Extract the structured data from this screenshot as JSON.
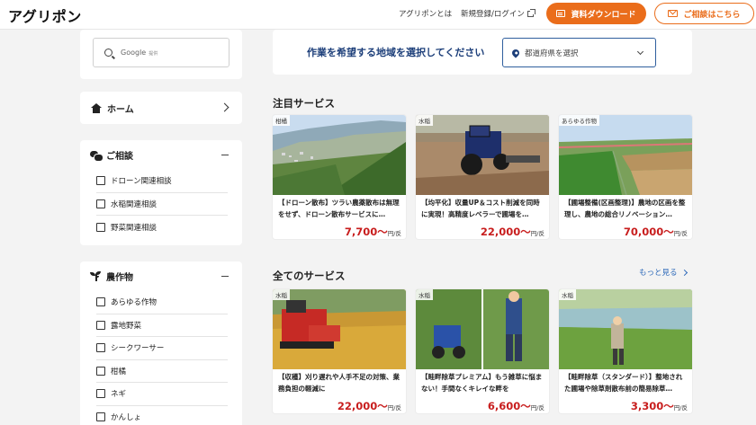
{
  "header": {
    "logo": "アグリポン",
    "nav_about": "アグリポンとは",
    "nav_login": "新規登録/ログイン",
    "download_button": "資料ダウンロード",
    "consult_button": "ご相談はこちら"
  },
  "sidebar": {
    "search": {
      "placeholder": "Google",
      "powered": "提供"
    },
    "home_label": "ホーム",
    "consult_group": {
      "title": "ご相談",
      "items": [
        "ドローン関連相談",
        "水稲関連相談",
        "野菜関連相談"
      ]
    },
    "crops_group": {
      "title": "農作物",
      "items": [
        "あらゆる作物",
        "露地野菜",
        "シークワーサー",
        "柑橘",
        "ネギ",
        "かんしょ"
      ]
    }
  },
  "main": {
    "region_prompt": "作業を希望する地域を選択してください",
    "region_select": "都道府県を選択",
    "featured_title": "注目サービス",
    "all_title": "全てのサービス",
    "more_link": "もっと見る",
    "price_unit": "円/反",
    "featured": [
      {
        "tag": "柑橘",
        "text": "【ドローン散布】ツラい農薬散布は無理をせず、ドローン散布サービスに…",
        "price": "7,700〜"
      },
      {
        "tag": "水稲",
        "text": "【均平化】収量UP＆コスト削減を同時に実現！高精度レベラーで圃場を…",
        "price": "22,000〜"
      },
      {
        "tag": "あらゆる作物",
        "text": "【圃場整備(区画整理)】農地の区画を整理し、農地の総合リノベーション…",
        "price": "70,000〜"
      }
    ],
    "all": [
      {
        "tag": "水稲",
        "text": "【収穫】刈り遅れや人手不足の対策、業務負担の軽減に",
        "price": "22,000〜"
      },
      {
        "tag": "水稲",
        "text": "【畦畔除草プレミアム】もう雑草に悩まない！手間なくキレイな畔を",
        "price": "6,600〜"
      },
      {
        "tag": "水稲",
        "text": "【畦畔除草（スタンダード）】整地された圃場や除草剤散布前の簡易除草…",
        "price": "3,300〜"
      }
    ]
  },
  "colors": {
    "accent": "#ea6d1b",
    "navy": "#1d3f7a",
    "price": "#c81e1e",
    "link": "#2a67b8"
  }
}
